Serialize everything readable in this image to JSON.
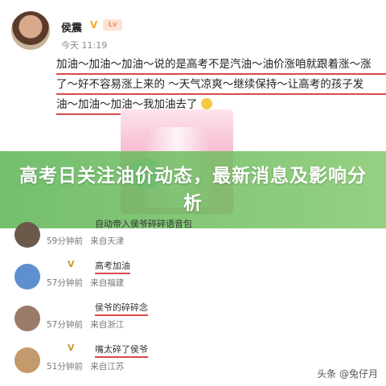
{
  "post": {
    "author": "侯震",
    "verified_mark": "V",
    "level_badge": "𝐈",
    "time": "今天 11:19",
    "lines": [
      "加油～加油～加油～说的是高考不是汽油～油价涨咱就跟着涨～涨",
      "了～好不容易涨上来的 ～天气凉爽～继续保持～让高考的孩子发",
      "油～加油～加油～我加油去了"
    ]
  },
  "banner": {
    "title": "高考日关注油价动态，最新消息及影响分析"
  },
  "comments": [
    {
      "prefix": "",
      "name": "自动帝入侯爷碎碎语音包",
      "time": "59分钟前",
      "source": "来自天津",
      "avatar_color": "#6b5a4a"
    },
    {
      "prefix": "V",
      "name": "高考加油",
      "time": "57分钟前",
      "source": "来自福建",
      "avatar_color": "#5d8fd1"
    },
    {
      "prefix": "",
      "name": "侯爷的碎碎念",
      "time": "57分钟前",
      "source": "来自浙江",
      "avatar_color": "#9a7b6a"
    },
    {
      "prefix": "V",
      "name": "嘴太碎了侯爷",
      "time": "51分钟前",
      "source": "来自江苏",
      "avatar_color": "#c49a6c"
    }
  ],
  "watermark": "头条 @兔仔月"
}
